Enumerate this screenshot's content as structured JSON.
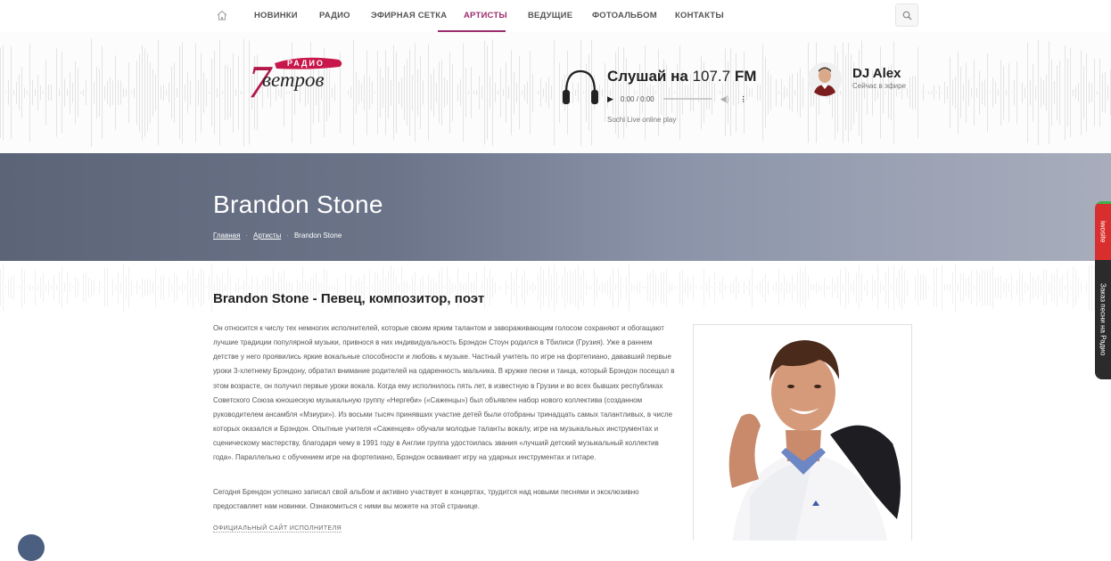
{
  "nav": {
    "items": [
      "НОВИНКИ",
      "РАДИО",
      "ЭФИРНАЯ СЕТКА",
      "АРТИСТЫ",
      "ВЕДУЩИЕ",
      "ФОТОАЛЬБОМ",
      "КОНТАКТЫ"
    ],
    "active": "АРТИСТЫ"
  },
  "logo": {
    "top_word": "РАДИО",
    "number": "7",
    "word": "ветров"
  },
  "player": {
    "listen_label": "Слушай на",
    "frequency": "107.7",
    "band": "FM",
    "time": "0:00 / 0:00",
    "caption": "Sochi Live online play"
  },
  "dj": {
    "name": "DJ Alex",
    "status": "Сейчас в эфире"
  },
  "hero": {
    "title": "Brandon Stone",
    "breadcrumb": [
      "Главная",
      "Артисты",
      "Brandon Stone"
    ]
  },
  "article": {
    "heading": "Brandon Stone - Певец, композитор, поэт",
    "paragraph1": "Он относится к числу тех немногих исполнителей, которые своим ярким талантом и завораживающим голосом сохраняют и обогащают лучшие традиции популярной музыки, привнося в них индивидуальность Брэндон Стоун родился в Тбилиси (Грузия). Уже в раннем детстве у него проявились яркие вокальные способности и любовь к музыке. Частный учитель по игре на фортепиано, дававший первые уроки 3-хлетнему Брэндону, обратил внимание родителей на одаренность мальчика. В кружке песни и танца, который Брэндон посещал в этом возрасте, он получил первые уроки вокала. Когда ему исполнилось пять лет, в известную в Грузии и во всех бывших республиках Советского Союза юношескую музыкальную группу «Нергеби» («Саженцы») был объявлен набор нового коллектива (созданном руководителем ансамбля «Мзиури»). Из восьми тысяч принявших участие детей были отобраны тринадцать самых талантливых, в числе которых оказался и Брэндон. Опытные учителя «Саженцев» обучали молодые таланты вокалу, игре на музыкальных инструментах и сценическому мастерству, благодаря чему в 1991 году в Англии группа удостоилась звания «лучший детский музыкальный коллектив года». Параллельно с обучением игре на фортепиано, Брэндон осваивает игру на ударных инструментах и гитаре.",
    "paragraph2": "Сегодня Брендон успешно записал свой альбом и активно участвует в концертах, трудится над новыми песнями и эксклюзивно предоставляет нам новинки. Ознакомиться с ними вы можете на этой странице.",
    "site_link": "ОФИЦИАЛЬНЫЙ САЙТ ИСПОЛНИТЕЛЯ"
  },
  "side_tab": {
    "top": "iwosite",
    "bottom": "Заказ песни на Радио"
  },
  "colors": {
    "accent": "#9b2c6d",
    "hero_start": "#5c6478",
    "hero_end": "#a8adbc"
  }
}
